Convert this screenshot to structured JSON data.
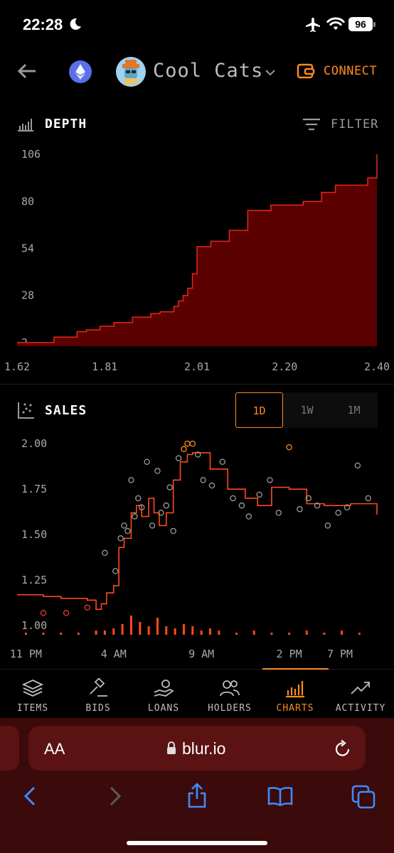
{
  "status_bar": {
    "time": "22:28",
    "battery": "96"
  },
  "header": {
    "collection_name": "Cool Cats",
    "connect_label": "CONNECT"
  },
  "depth": {
    "label": "DEPTH",
    "filter_label": "FILTER",
    "y_ticks": [
      "106",
      "80",
      "54",
      "28",
      "2"
    ],
    "x_ticks": [
      "1.62",
      "1.81",
      "2.01",
      "2.20",
      "2.40"
    ]
  },
  "sales": {
    "label": "SALES",
    "ranges": [
      "1D",
      "1W",
      "1M"
    ],
    "active_range": "1D",
    "y_ticks": [
      "2.00",
      "1.75",
      "1.50",
      "1.25",
      "1.00"
    ],
    "x_ticks": [
      "11 PM",
      "4 AM",
      "9 AM",
      "2 PM",
      "7 PM"
    ]
  },
  "nav": {
    "items": [
      {
        "label": "ITEMS",
        "icon": "layers-icon"
      },
      {
        "label": "BIDS",
        "icon": "gavel-icon"
      },
      {
        "label": "LOANS",
        "icon": "hand-coin-icon"
      },
      {
        "label": "HOLDERS",
        "icon": "users-icon"
      },
      {
        "label": "CHARTS",
        "icon": "bar-chart-icon"
      },
      {
        "label": "ACTIVITY",
        "icon": "trend-up-icon"
      }
    ],
    "active": "CHARTS"
  },
  "browser": {
    "aa_label": "AA",
    "url": "blur.io"
  },
  "colors": {
    "accent": "#ff8a1f",
    "depth_fill": "#5a0000",
    "depth_line": "#e8281a",
    "sales_line": "#ff4a1a"
  },
  "chart_data": [
    {
      "type": "area",
      "title": "DEPTH",
      "x": [
        1.62,
        1.67,
        1.7,
        1.74,
        1.75,
        1.77,
        1.8,
        1.83,
        1.87,
        1.91,
        1.93,
        1.96,
        1.97,
        1.98,
        1.99,
        2.0,
        2.01,
        2.04,
        2.08,
        2.12,
        2.17,
        2.24,
        2.28,
        2.31,
        2.38,
        2.4
      ],
      "values": [
        2,
        2,
        5,
        5,
        8,
        9,
        11,
        13,
        16,
        18,
        19,
        22,
        25,
        28,
        32,
        40,
        55,
        58,
        64,
        75,
        78,
        80,
        85,
        89,
        93,
        106
      ],
      "xlim": [
        1.62,
        2.4
      ],
      "ylim": [
        0,
        110
      ]
    },
    {
      "type": "scatter",
      "title": "SALES",
      "x_axis": "time (hours since 11 PM)",
      "xlim": [
        -0.5,
        20
      ],
      "ylim": [
        0.95,
        2.02
      ],
      "series": [
        {
          "kind": "floor-line",
          "x": [
            -0.5,
            1,
            2,
            3.5,
            4,
            4.3,
            4.6,
            5,
            5.3,
            5.6,
            6.0,
            6.3,
            6.6,
            7,
            7.3,
            7.6,
            8,
            8.4,
            8.8,
            9.2,
            9.5,
            9.8,
            10.5,
            11.5,
            12.5,
            13.2,
            14,
            15,
            16,
            17,
            18.5,
            20
          ],
          "y": [
            1.17,
            1.16,
            1.15,
            1.14,
            1.09,
            1.12,
            1.18,
            1.22,
            1.43,
            1.48,
            1.62,
            1.66,
            1.6,
            1.7,
            1.62,
            1.55,
            1.62,
            1.8,
            1.9,
            1.94,
            1.95,
            1.95,
            1.86,
            1.75,
            1.7,
            1.66,
            1.76,
            1.75,
            1.67,
            1.66,
            1.67,
            1.61
          ]
        },
        {
          "kind": "sales",
          "x": [
            1,
            2.3,
            3.5,
            4.5,
            5.1,
            5.4,
            5.6,
            5.8,
            6.0,
            6.2,
            6.4,
            6.6,
            6.9,
            7.2,
            7.5,
            7.7,
            8.0,
            8.2,
            8.4,
            8.7,
            9.0,
            9.2,
            9.5,
            9.8,
            10.1,
            10.6,
            11.2,
            11.8,
            12.3,
            12.7,
            13.3,
            13.9,
            14.4,
            15.0,
            15.6,
            16.1,
            16.6,
            17.2,
            17.8,
            18.3,
            18.9,
            19.5
          ],
          "y": [
            1.07,
            1.07,
            1.1,
            1.4,
            1.3,
            1.48,
            1.55,
            1.52,
            1.8,
            1.6,
            1.7,
            1.65,
            1.9,
            1.55,
            1.85,
            1.62,
            1.66,
            1.76,
            1.52,
            1.92,
            1.97,
            2.0,
            2.0,
            1.94,
            1.8,
            1.77,
            1.9,
            1.7,
            1.66,
            1.6,
            1.72,
            1.8,
            1.62,
            1.98,
            1.64,
            1.7,
            1.66,
            1.55,
            1.62,
            1.65,
            1.88,
            1.7
          ]
        },
        {
          "kind": "volume",
          "x": [
            0,
            1,
            2,
            3,
            4,
            4.5,
            5,
            5.5,
            6,
            6.5,
            7,
            7.5,
            8,
            8.5,
            9,
            9.5,
            10,
            10.5,
            11,
            12,
            13,
            14,
            15,
            16,
            17,
            18,
            19
          ],
          "y": [
            1,
            1,
            1,
            1,
            2,
            2,
            3,
            5,
            9,
            6,
            4,
            8,
            4,
            3,
            5,
            4,
            2,
            3,
            2,
            1,
            2,
            1,
            1,
            2,
            1,
            2,
            1
          ]
        }
      ]
    }
  ]
}
